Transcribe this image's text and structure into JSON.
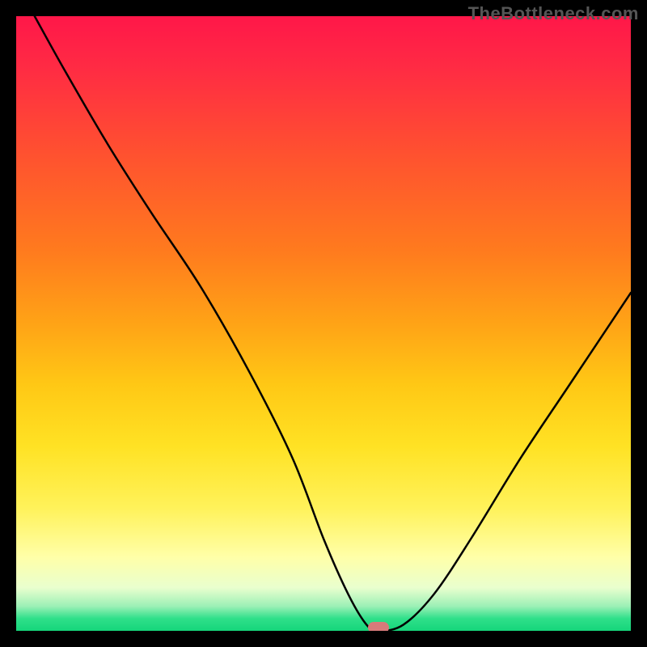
{
  "watermark": "TheBottleneck.com",
  "colors": {
    "marker": "#d77a7a"
  },
  "chart_data": {
    "type": "line",
    "title": "",
    "xlabel": "",
    "ylabel": "",
    "xlim": [
      0,
      100
    ],
    "ylim": [
      0,
      100
    ],
    "series": [
      {
        "name": "bottleneck-curve",
        "x": [
          3,
          8,
          15,
          22,
          30,
          38,
          45,
          50,
          54,
          57,
          59,
          63,
          68,
          74,
          82,
          90,
          100
        ],
        "y": [
          100,
          91,
          79,
          68,
          56,
          42,
          28,
          15,
          6,
          1,
          0,
          1,
          6,
          15,
          28,
          40,
          55
        ]
      }
    ],
    "minimum_marker": {
      "x": 59,
      "y": 0
    }
  }
}
